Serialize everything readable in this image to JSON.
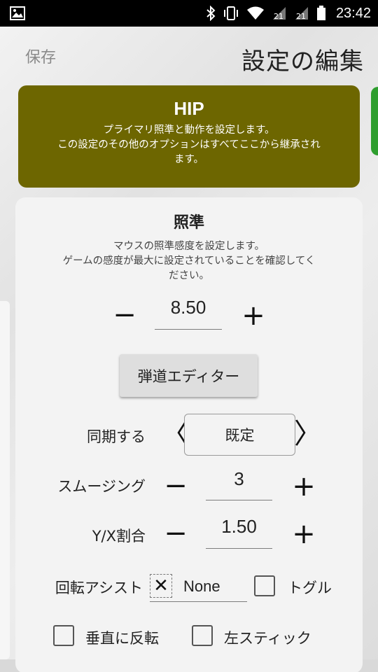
{
  "status_bar": {
    "time": "23:42",
    "icons": [
      "image-notification-icon",
      "bluetooth-icon",
      "vibrate-icon",
      "wifi-icon",
      "sim1-signal-icon",
      "sim2-signal-icon",
      "battery-icon"
    ],
    "signal_badges": [
      "21",
      "21"
    ]
  },
  "header": {
    "save_label": "保存",
    "title": "設定の編集"
  },
  "hip_card": {
    "title": "HIP",
    "description_line1": "プライマリ照準と動作を設定します。",
    "description_line2": "この設定のその他のオプションはすべてここから継承され",
    "description_line3": "ます。",
    "color": "#6d6600"
  },
  "next_card_color": "#2e9e2e",
  "aim": {
    "title": "照準",
    "description_line1": "マウスの照準感度を設定します。",
    "description_line2": "ゲームの感度が最大に設定されていることを確認してく",
    "description_line3": "ださい。",
    "sensitivity": {
      "minus": "−",
      "value": "8.50",
      "plus": "+"
    },
    "ballistic_editor_label": "弾道エディター",
    "sync": {
      "label": "同期する",
      "prev": "〈",
      "value": "既定",
      "next": "〉"
    },
    "smoothing": {
      "label": "スムージング",
      "minus": "−",
      "value": "3",
      "plus": "+"
    },
    "yx_ratio": {
      "label": "Y/X割合",
      "minus": "−",
      "value": "1.50",
      "plus": "+"
    },
    "rotation_assist": {
      "label": "回転アシスト",
      "x_mark": "✕",
      "value": "None"
    },
    "toggle_label": "トグル",
    "invert_vertical_label": "垂直に反転",
    "left_stick_label": "左スティック"
  }
}
